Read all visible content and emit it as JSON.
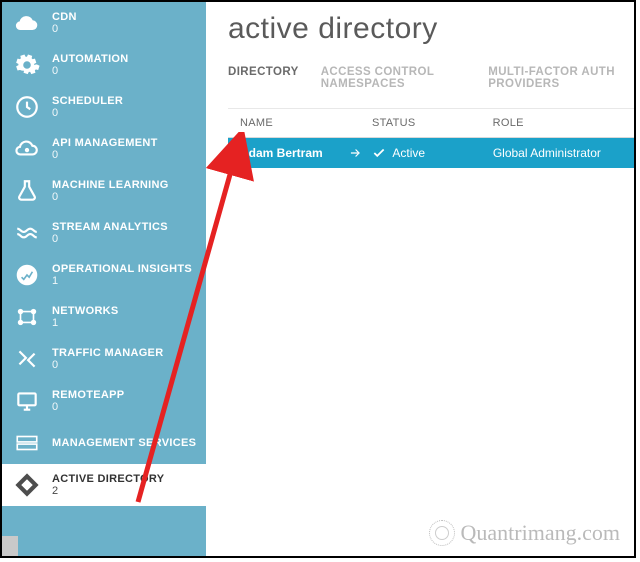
{
  "sidebar": {
    "items": [
      {
        "label": "CDN",
        "count": "0"
      },
      {
        "label": "AUTOMATION",
        "count": "0"
      },
      {
        "label": "SCHEDULER",
        "count": "0"
      },
      {
        "label": "API MANAGEMENT",
        "count": "0"
      },
      {
        "label": "MACHINE LEARNING",
        "count": "0"
      },
      {
        "label": "STREAM ANALYTICS",
        "count": "0"
      },
      {
        "label": "OPERATIONAL INSIGHTS",
        "count": "1"
      },
      {
        "label": "NETWORKS",
        "count": "1"
      },
      {
        "label": "TRAFFIC MANAGER",
        "count": "0"
      },
      {
        "label": "REMOTEAPP",
        "count": "0"
      },
      {
        "label": "MANAGEMENT SERVICES",
        "count": ""
      },
      {
        "label": "ACTIVE DIRECTORY",
        "count": "2"
      }
    ]
  },
  "page": {
    "title": "active directory"
  },
  "tabs": [
    {
      "label": "DIRECTORY",
      "active": true
    },
    {
      "label": "ACCESS CONTROL NAMESPACES",
      "active": false
    },
    {
      "label": "MULTI-FACTOR AUTH PROVIDERS",
      "active": false
    }
  ],
  "table": {
    "columns": {
      "name": "NAME",
      "status": "STATUS",
      "role": "ROLE"
    },
    "rows": [
      {
        "name": "Adam Bertram",
        "status": "Active",
        "role": "Global Administrator"
      }
    ]
  },
  "watermark": "Quantrimang.com"
}
